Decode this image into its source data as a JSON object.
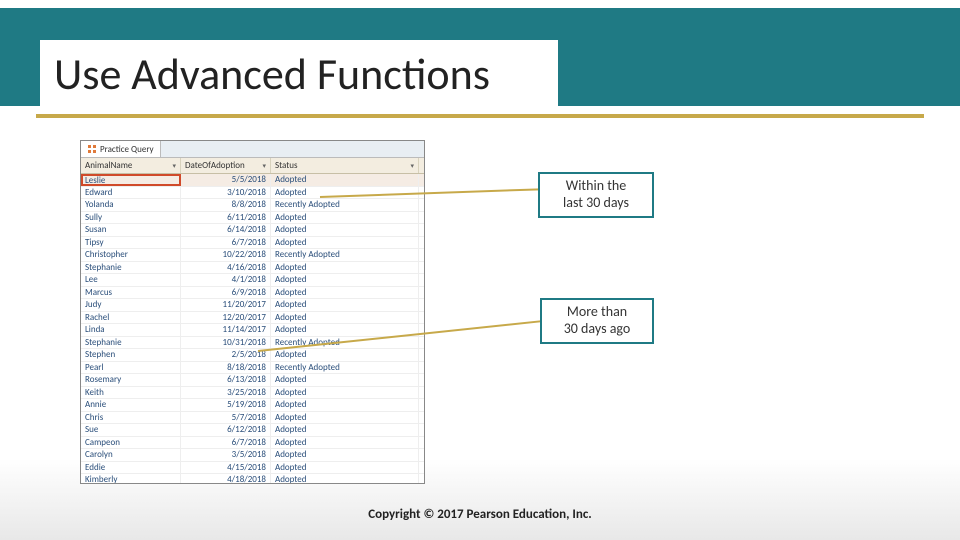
{
  "title": "Use Advanced Functions",
  "callouts": {
    "recent": {
      "line1": "Within the",
      "line2": "last 30 days"
    },
    "older": {
      "line1": "More than",
      "line2": "30 days ago"
    }
  },
  "tab": "Practice Query",
  "columns": {
    "name": "AnimalName",
    "date": "DateOfAdoption",
    "status": "Status"
  },
  "rows": [
    {
      "name": "Leslie",
      "date": "5/5/2018",
      "status": "Adopted",
      "sel": true
    },
    {
      "name": "Edward",
      "date": "3/10/2018",
      "status": "Adopted"
    },
    {
      "name": "Yolanda",
      "date": "8/8/2018",
      "status": "Recently Adopted"
    },
    {
      "name": "Sully",
      "date": "6/11/2018",
      "status": "Adopted"
    },
    {
      "name": "Susan",
      "date": "6/14/2018",
      "status": "Adopted"
    },
    {
      "name": "Tipsy",
      "date": "6/7/2018",
      "status": "Adopted"
    },
    {
      "name": "Christopher",
      "date": "10/22/2018",
      "status": "Recently Adopted"
    },
    {
      "name": "Stephanie",
      "date": "4/16/2018",
      "status": "Adopted"
    },
    {
      "name": "Lee",
      "date": "4/1/2018",
      "status": "Adopted"
    },
    {
      "name": "Marcus",
      "date": "6/9/2018",
      "status": "Adopted"
    },
    {
      "name": "Judy",
      "date": "11/20/2017",
      "status": "Adopted"
    },
    {
      "name": "Rachel",
      "date": "12/20/2017",
      "status": "Adopted"
    },
    {
      "name": "Linda",
      "date": "11/14/2017",
      "status": "Adopted"
    },
    {
      "name": "Stephanie",
      "date": "10/31/2018",
      "status": "Recently Adopted"
    },
    {
      "name": "Stephen",
      "date": "2/5/2018",
      "status": "Adopted"
    },
    {
      "name": "Pearl",
      "date": "8/18/2018",
      "status": "Recently Adopted"
    },
    {
      "name": "Rosemary",
      "date": "6/13/2018",
      "status": "Adopted"
    },
    {
      "name": "Keith",
      "date": "3/25/2018",
      "status": "Adopted"
    },
    {
      "name": "Annie",
      "date": "5/19/2018",
      "status": "Adopted"
    },
    {
      "name": "Chris",
      "date": "5/7/2018",
      "status": "Adopted"
    },
    {
      "name": "Sue",
      "date": "6/12/2018",
      "status": "Adopted"
    },
    {
      "name": "Campeon",
      "date": "6/7/2018",
      "status": "Adopted"
    },
    {
      "name": "Carolyn",
      "date": "3/5/2018",
      "status": "Adopted"
    },
    {
      "name": "Eddie",
      "date": "4/15/2018",
      "status": "Adopted"
    },
    {
      "name": "Kimberly",
      "date": "4/18/2018",
      "status": "Adopted"
    }
  ],
  "copyright": "Copyright © 2017 Pearson Education, Inc."
}
